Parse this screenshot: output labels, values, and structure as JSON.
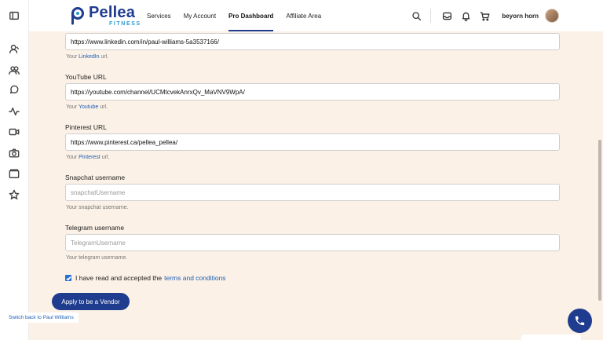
{
  "header": {
    "logo": {
      "name": "Pellea",
      "sub": "FITNESS"
    },
    "nav": [
      {
        "label": "Services",
        "active": false
      },
      {
        "label": "My Account",
        "active": false
      },
      {
        "label": "Pro Dashboard",
        "active": true
      },
      {
        "label": "Affiliate Area",
        "active": false
      }
    ],
    "user_name": "beyorn horn",
    "icons": [
      "search-icon",
      "inbox-icon",
      "bell-icon",
      "cart-icon"
    ]
  },
  "sidebar": {
    "icons": [
      "sidebar-toggle-icon",
      "user-icon",
      "users-icon",
      "chat-icon",
      "activity-icon",
      "video-icon",
      "camera-icon",
      "folder-icon",
      "star-icon"
    ]
  },
  "form": {
    "linkedin": {
      "value": "https://www.linkedin.com/in/paul-williams-5a3537166/",
      "help_prefix": "Your",
      "help_link": "LinkedIn",
      "help_suffix": "url."
    },
    "youtube": {
      "label": "YouTube URL",
      "value": "https://youtube.com/channel/UCMtcvekAnrxQv_MaVNV9WpA/",
      "help_prefix": "Your",
      "help_link": "Youtube",
      "help_suffix": "url."
    },
    "pinterest": {
      "label": "Pinterest URL",
      "value": "https://www.pinterest.ca/pellea_pellea/",
      "help_prefix": "Your",
      "help_link": "Pinterest",
      "help_suffix": "url."
    },
    "snapchat": {
      "label": "Snapchat username",
      "placeholder": "snapchatUsername",
      "help": "Your snapchat username."
    },
    "telegram": {
      "label": "Telegram username",
      "placeholder": "TelegramUsername",
      "help": "Your telegram username."
    },
    "terms": {
      "checked": true,
      "text": "I have read and accepted the",
      "link": "terms and conditions"
    },
    "submit_label": "Apply to be a Vendor"
  },
  "switch_back_label": "Switch back to Paul Williams",
  "colors": {
    "brand": "#1f3c8f",
    "accent": "#2a9bd1",
    "link": "#1f5fb5",
    "page_bg": "#fbf1e6"
  }
}
